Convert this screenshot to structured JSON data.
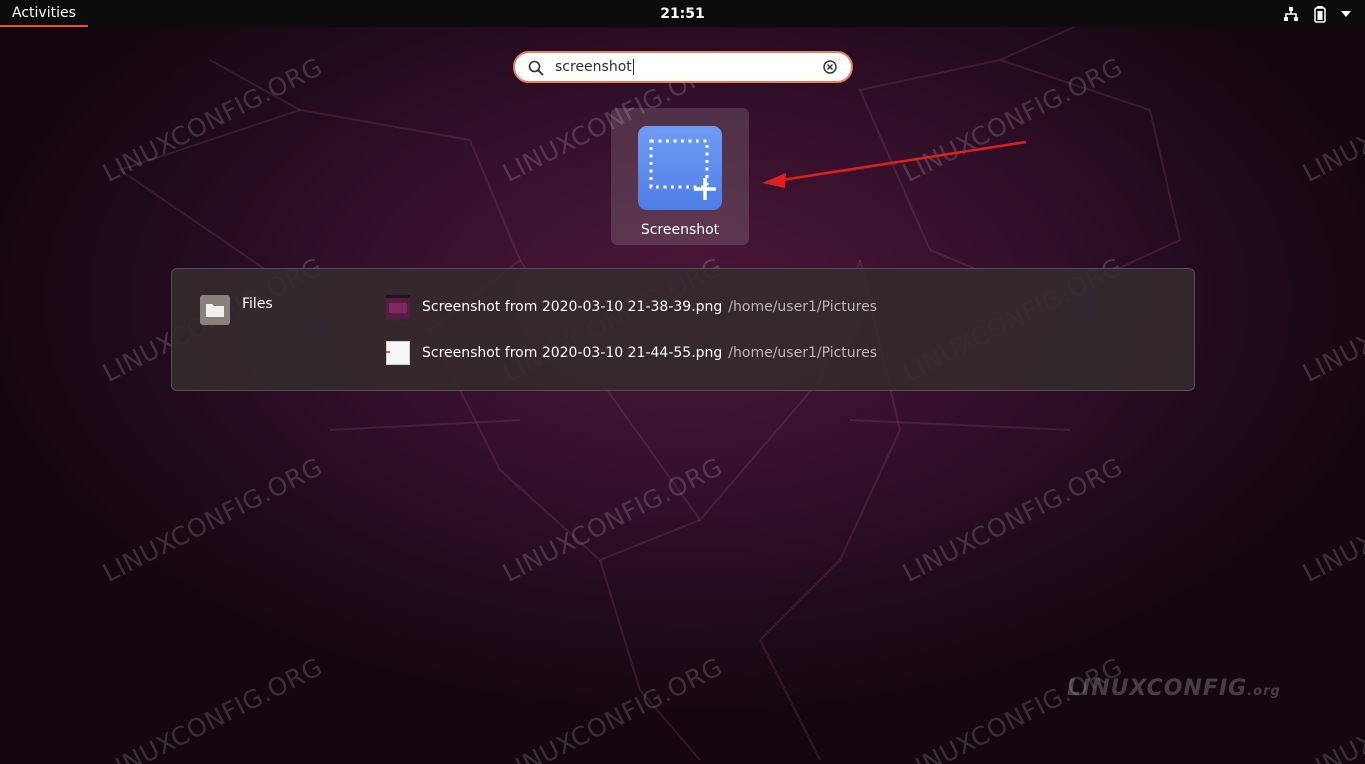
{
  "topbar": {
    "activities_label": "Activities",
    "clock": "21:51",
    "tray_icons": [
      "network-icon",
      "battery-icon",
      "menu-arrow-icon"
    ]
  },
  "search": {
    "value": "screenshot",
    "icon": "search-icon",
    "clear_icon": "clear-icon"
  },
  "app_result": {
    "name": "Screenshot",
    "icon": "screenshot-app-icon",
    "icon_color": "#5b8bf0"
  },
  "files": {
    "provider_name": "Files",
    "provider_icon": "folder-icon",
    "results": [
      {
        "name": "Screenshot from 2020-03-10 21-38-39.png",
        "path": "/home/user1/Pictures",
        "thumb": "purple-thumbnail"
      },
      {
        "name": "Screenshot from 2020-03-10 21-44-55.png",
        "path": "/home/user1/Pictures",
        "thumb": "white-thumbnail"
      }
    ]
  },
  "watermark": {
    "text": "LINUXCONFIG.ORG",
    "logo_main": "LINUXCONFIG",
    "logo_suffix": ".org"
  },
  "colors": {
    "accent": "#e95420",
    "arrow": "#e02020",
    "topbar_bg": "#0c0c0c"
  }
}
